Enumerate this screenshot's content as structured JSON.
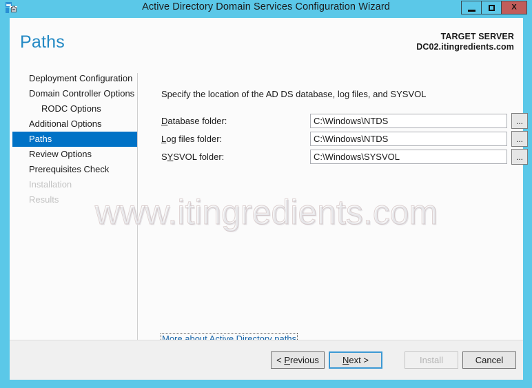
{
  "window": {
    "title": "Active Directory Domain Services Configuration Wizard",
    "icon": "server-manager-icon",
    "minimize_label": "–",
    "maximize_label": "❑",
    "close_label": "X",
    "titlebar_color": "#5bc8e8",
    "close_color": "#c15d5a"
  },
  "header": {
    "page_title": "Paths",
    "target_server_label": "TARGET SERVER",
    "target_server_name": "DC02.itingredients.com",
    "accent_color": "#2389c4"
  },
  "steps": {
    "selected_color": "#0072c6",
    "items": [
      {
        "label": "Deployment Configuration",
        "state": "normal",
        "indented": false
      },
      {
        "label": "Domain Controller Options",
        "state": "normal",
        "indented": false
      },
      {
        "label": "RODC Options",
        "state": "normal",
        "indented": true
      },
      {
        "label": "Additional Options",
        "state": "normal",
        "indented": false
      },
      {
        "label": "Paths",
        "state": "selected",
        "indented": false
      },
      {
        "label": "Review Options",
        "state": "normal",
        "indented": false
      },
      {
        "label": "Prerequisites Check",
        "state": "normal",
        "indented": false
      },
      {
        "label": "Installation",
        "state": "disabled",
        "indented": false
      },
      {
        "label": "Results",
        "state": "disabled",
        "indented": false
      }
    ]
  },
  "content": {
    "intro": "Specify the location of the AD DS database, log files, and SYSVOL",
    "fields": [
      {
        "label_pre": "",
        "label_key": "D",
        "label_post": "atabase folder:",
        "value": "C:\\Windows\\NTDS",
        "browse_label": "..."
      },
      {
        "label_pre": "",
        "label_key": "L",
        "label_post": "og files folder:",
        "value": "C:\\Windows\\NTDS",
        "browse_label": "..."
      },
      {
        "label_pre": "S",
        "label_key": "Y",
        "label_post": "SVOL folder:",
        "value": "C:\\Windows\\SYSVOL",
        "browse_label": "..."
      }
    ],
    "more_link": "More about Active Directory paths",
    "link_color": "#1764a8"
  },
  "watermark": {
    "text": "www.itingredients.com"
  },
  "footer": {
    "previous_pre": "< ",
    "previous_key": "P",
    "previous_post": "revious",
    "next_key": "N",
    "next_post": "ext >",
    "install_label": "Install",
    "cancel_label": "Cancel",
    "default_button": "Next >",
    "disabled_button": "Install"
  }
}
